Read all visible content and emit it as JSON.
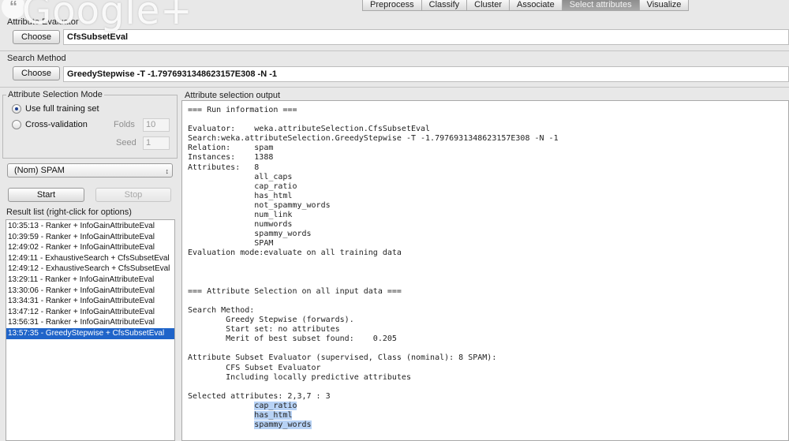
{
  "tabs": [
    {
      "label": "Preprocess",
      "active": false
    },
    {
      "label": "Classify",
      "active": false
    },
    {
      "label": "Cluster",
      "active": false
    },
    {
      "label": "Associate",
      "active": false
    },
    {
      "label": "Select attributes",
      "active": true
    },
    {
      "label": "Visualize",
      "active": false
    }
  ],
  "watermark": {
    "text": "Google+"
  },
  "attribute_evaluator": {
    "section_label": "Attribute Evaluator",
    "choose_label": "Choose",
    "value": "CfsSubsetEval"
  },
  "search_method": {
    "section_label": "Search Method",
    "choose_label": "Choose",
    "value": "GreedyStepwise -T -1.7976931348623157E308 -N -1"
  },
  "selection_mode": {
    "section_label": "Attribute Selection Mode",
    "full_training_label": "Use full training set",
    "cross_validation_label": "Cross-validation",
    "selected": "full",
    "folds_label": "Folds",
    "folds_value": "10",
    "seed_label": "Seed",
    "seed_value": "1"
  },
  "class_select": {
    "value": "(Nom)  SPAM"
  },
  "actions": {
    "start_label": "Start",
    "stop_label": "Stop"
  },
  "result_list": {
    "section_label": "Result list (right-click for options)",
    "items": [
      "10:35:13 - Ranker + InfoGainAttributeEval",
      "10:39:59 - Ranker + InfoGainAttributeEval",
      "12:49:02 - Ranker + InfoGainAttributeEval",
      "12:49:11 - ExhaustiveSearch + CfsSubsetEval",
      "12:49:12 - ExhaustiveSearch + CfsSubsetEval",
      "13:29:11 - Ranker + InfoGainAttributeEval",
      "13:30:06 - Ranker + InfoGainAttributeEval",
      "13:34:31 - Ranker + InfoGainAttributeEval",
      "13:47:12 - Ranker + InfoGainAttributeEval",
      "13:56:31 - Ranker + InfoGainAttributeEval",
      "13:57:35 - GreedyStepwise + CfsSubsetEval"
    ],
    "selected_index": 10
  },
  "output": {
    "section_label": "Attribute selection output",
    "lines": [
      "=== Run information ===",
      "",
      "Evaluator:    weka.attributeSelection.CfsSubsetEval",
      "Search:weka.attributeSelection.GreedyStepwise -T -1.7976931348623157E308 -N -1",
      "Relation:     spam",
      "Instances:    1388",
      "Attributes:   8",
      "              all_caps",
      "              cap_ratio",
      "              has_html",
      "              not_spammy_words",
      "              num_link",
      "              numwords",
      "              spammy_words",
      "              SPAM",
      "Evaluation mode:evaluate on all training data",
      "",
      "",
      "",
      "=== Attribute Selection on all input data ===",
      "",
      "Search Method:",
      "        Greedy Stepwise (forwards).",
      "        Start set: no attributes",
      "        Merit of best subset found:    0.205",
      "",
      "Attribute Subset Evaluator (supervised, Class (nominal): 8 SPAM):",
      "        CFS Subset Evaluator",
      "        Including locally predictive attributes",
      "",
      "Selected attributes: 2,3,7 : 3"
    ],
    "highlighted_lines": [
      "cap_ratio",
      "has_html",
      "spammy_words"
    ]
  }
}
